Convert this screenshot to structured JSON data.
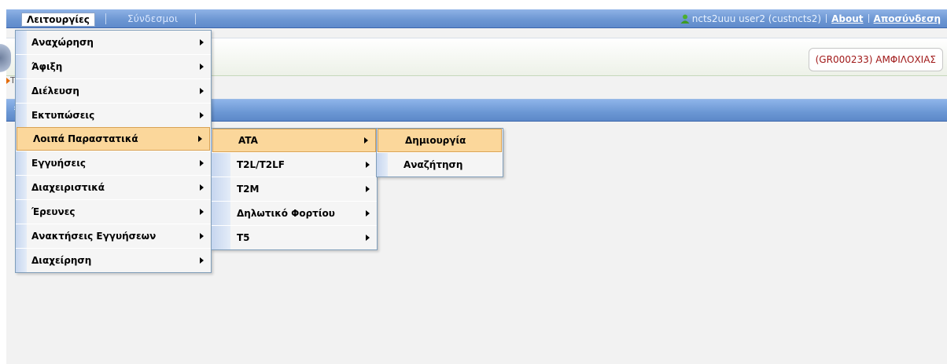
{
  "menubar": {
    "menu1": "Λειτουργίες",
    "menu2": "Σύνδεσμοι",
    "user": "ncts2uuu user2 (custncts2)",
    "about": "About",
    "logout": "Αποσύνδεση"
  },
  "header": {
    "station": "(GR000233) ΑΜΦΙΛΟΧΙΑΣ",
    "breadcrumb_char": "T",
    "subbar_chevron": "›"
  },
  "main_menu": [
    {
      "label": "Αναχώρηση"
    },
    {
      "label": "Άφιξη"
    },
    {
      "label": "Διέλευση"
    },
    {
      "label": "Εκτυπώσεις"
    },
    {
      "label": "Λοιπά Παραστατικά"
    },
    {
      "label": "Εγγυήσεις"
    },
    {
      "label": "Διαχειριστικά"
    },
    {
      "label": "Έρευνες"
    },
    {
      "label": "Ανακτήσεις Εγγυήσεων"
    },
    {
      "label": "Διαχείρηση"
    }
  ],
  "submenu_loipa": [
    {
      "label": "ATA"
    },
    {
      "label": "T2L/T2LF"
    },
    {
      "label": "T2M"
    },
    {
      "label": "Δηλωτικό Φορτίου"
    },
    {
      "label": "T5"
    }
  ],
  "submenu_ata": [
    {
      "label": "Δημιουργία"
    },
    {
      "label": "Αναζήτηση"
    }
  ],
  "colors": {
    "menubar": "#6d97d3",
    "active_item": "#fbd79b",
    "station_text": "#a01818"
  }
}
